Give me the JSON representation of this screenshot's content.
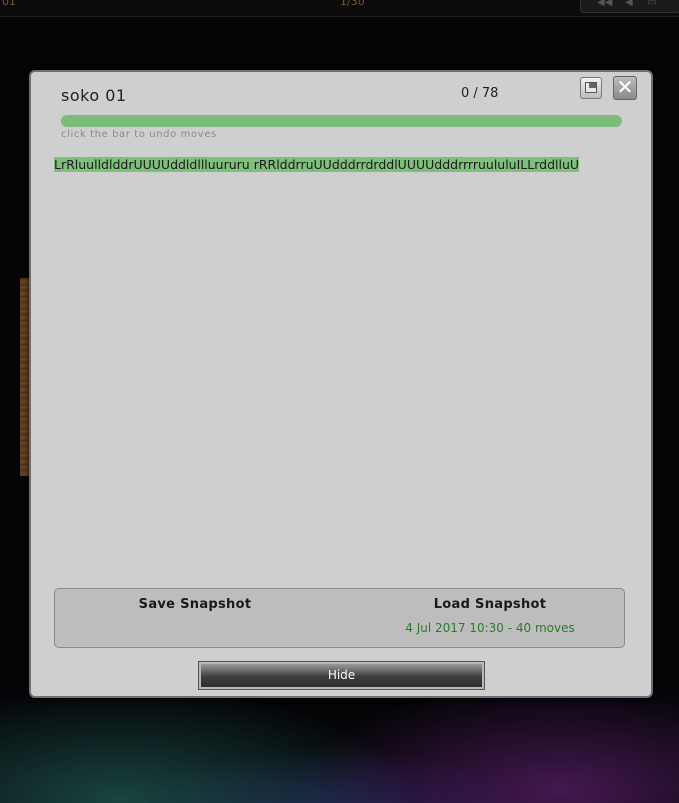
{
  "background": {
    "top_bar": {
      "left_text": "01",
      "center_text": "1/30",
      "controls": [
        "◀◀",
        "◀",
        "▭"
      ]
    }
  },
  "dialog": {
    "level_name": "soko 01",
    "move_counter": "0 / 78",
    "progress": 0,
    "hint": "click the bar to undo moves",
    "moves": "LrRluulldlddrUUUUddldllluururu rRRlddrruUUdddrrdrddlUUUUdddrrrruululuILLrddlluU",
    "buttons": {
      "window_icon": "window-icon",
      "close_icon": "close-icon",
      "close_glyph": "✕"
    },
    "snapshot": {
      "save_label": "Save Snapshot",
      "load_label": "Load Snapshot",
      "load_info": "4 Jul 2017 10:30 - 40 moves"
    },
    "hide_label": "Hide"
  },
  "colors": {
    "accent_green": "#7dbb7a",
    "snapshot_info_green": "#2d7a2d",
    "dialog_bg": "#cfcfcf"
  }
}
